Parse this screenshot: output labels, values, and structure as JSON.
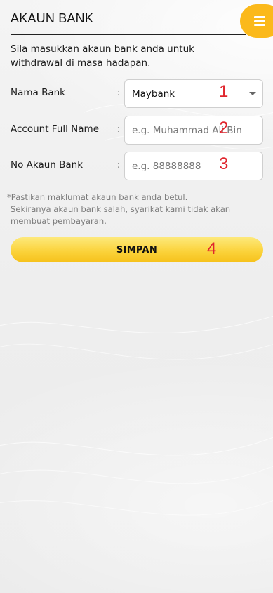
{
  "header": {
    "title": "AKAUN BANK",
    "menu_icon": "hamburger-menu-icon",
    "accent_color": "#fbb91b"
  },
  "intro_text": "Sila masukkan akaun bank anda untuk withdrawal di masa hadapan.",
  "form": {
    "bank_name": {
      "label": "Nama Bank",
      "colon": ":",
      "selected_value": "Maybank"
    },
    "full_name": {
      "label": "Account Full Name",
      "colon": ":",
      "placeholder": "e.g. Muhammad Ali Bin"
    },
    "account_no": {
      "label": "No Akaun Bank",
      "colon": ":",
      "placeholder": "e.g. 88888888"
    }
  },
  "note": {
    "line1": "*Pastikan maklumat akaun bank anda betul.",
    "line2": "Sekiranya akaun bank salah, syarikat kami tidak akan membuat pembayaran."
  },
  "save_button": {
    "label": "SIMPAN"
  },
  "annotations": {
    "m1": "1",
    "m2": "2",
    "m3": "3",
    "m4": "4",
    "color": "#e0262e"
  }
}
